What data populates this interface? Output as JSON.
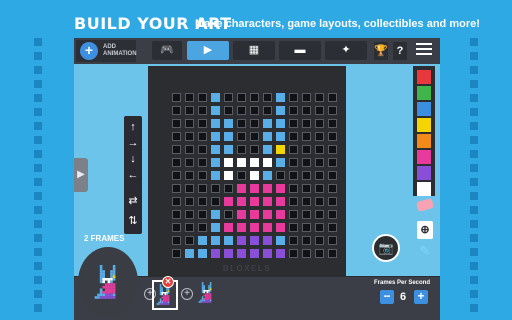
{
  "banner": {
    "title": "BUILD YOUR ART",
    "subtitle": "Make characters, game layouts, collectibles and more!"
  },
  "toolbar": {
    "add_label_line1": "ADD",
    "add_label_line2": "ANIMATION",
    "add_symbol": "+",
    "tabs": [
      {
        "icon": "gamepad-icon",
        "glyph": "🎮",
        "active": false
      },
      {
        "icon": "animation-icon",
        "glyph": "▶",
        "active": true
      },
      {
        "icon": "background-icon",
        "glyph": "▦",
        "active": false
      },
      {
        "icon": "board-icon",
        "glyph": "▬",
        "active": false
      },
      {
        "icon": "character-icon",
        "glyph": "✦",
        "active": false
      }
    ],
    "trophy_glyph": "🏆",
    "help_glyph": "?"
  },
  "canvas": {
    "logo_text": "BLOXELS",
    "grid_size": 13,
    "colors": {
      "b": "#5aaee8",
      "y": "#f5d500",
      "w": "#ffffff",
      "m": "#e73a9c",
      "p": "#8a4fd8",
      "k": "#111215"
    },
    "rows": [
      "kkkbkkkkbkkkk",
      "kkkbkkkkbkkkk",
      "kkkbbkkbbkkkk",
      "kkkbbkkbbkkkk",
      "kkkbbkkbykkkk",
      "kkkbwwwwbkkkk",
      "kkkbwkwbkkkkk",
      "kkkkkmmmmkkkk",
      "kkkkmmmmmkkkk",
      "kkkbkmmmmkkkk",
      "kkkbmmmmmkkkk",
      "kkbbbpppbkkkk",
      "kbbppppppkkkk"
    ]
  },
  "tools": [
    {
      "name": "up-arrow-icon",
      "glyph": "↑"
    },
    {
      "name": "right-arrow-icon",
      "glyph": "→"
    },
    {
      "name": "down-arrow-icon",
      "glyph": "↓"
    },
    {
      "name": "left-arrow-icon",
      "glyph": "←"
    },
    {
      "name": "flip-horizontal-icon",
      "glyph": "⇄"
    },
    {
      "name": "flip-vertical-icon",
      "glyph": "⇅"
    }
  ],
  "side_arrow_glyph": "▶",
  "palette": [
    "#e8383d",
    "#3fb54b",
    "#3c8fe0",
    "#f5d500",
    "#f28a1a",
    "#e73a9c",
    "#8a4fd8",
    "#ffffff"
  ],
  "frames": {
    "label": "2 FRAMES",
    "delete_glyph": "✕"
  },
  "fps": {
    "label": "Frames Per Second",
    "value": "6",
    "minus": "−",
    "plus": "+"
  },
  "side_tools": {
    "copy_glyph": "⊕",
    "brush_glyph": "✎",
    "camera_glyph": "📷"
  }
}
